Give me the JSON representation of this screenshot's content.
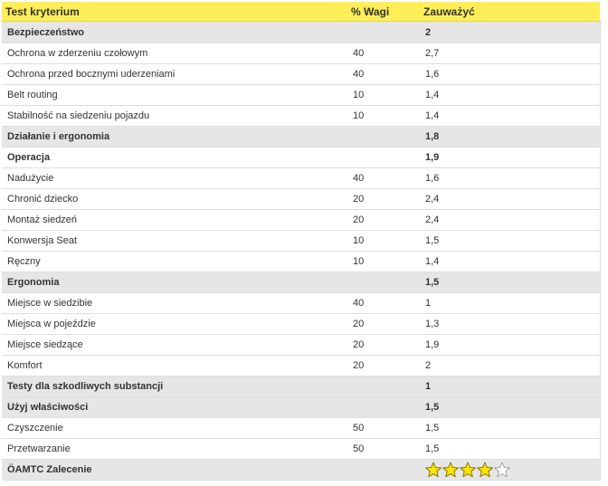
{
  "table": {
    "headers": [
      "Test kryterium",
      "% Wagi",
      "Zauważyć"
    ],
    "rows": [
      {
        "kind": "sec",
        "label": "Bezpieczeństwo",
        "weight": "",
        "value": "2"
      },
      {
        "kind": "item",
        "label": "Ochrona w zderzeniu czołowym",
        "weight": "40",
        "value": "2,7"
      },
      {
        "kind": "item",
        "label": "Ochrona przed bocznymi uderzeniami",
        "weight": "40",
        "value": "1,6"
      },
      {
        "kind": "item",
        "label": "Belt routing",
        "weight": "10",
        "value": "1,4"
      },
      {
        "kind": "item",
        "label": "Stabilność na siedzeniu pojazdu",
        "weight": "10",
        "value": "1,4"
      },
      {
        "kind": "sec",
        "label": "Działanie i ergonomia",
        "weight": "",
        "value": "1,8"
      },
      {
        "kind": "sub",
        "label": "Operacja",
        "weight": "",
        "value": "1,9"
      },
      {
        "kind": "item",
        "label": "Nadużycie",
        "weight": "40",
        "value": "1,6"
      },
      {
        "kind": "item",
        "label": "Chronić dziecko",
        "weight": "20",
        "value": "2,4"
      },
      {
        "kind": "item",
        "label": "Montaż siedzeń",
        "weight": "20",
        "value": "2,4"
      },
      {
        "kind": "item",
        "label": "Konwersja Seat",
        "weight": "10",
        "value": "1,5"
      },
      {
        "kind": "item",
        "label": "Ręczny",
        "weight": "10",
        "value": "1,4"
      },
      {
        "kind": "sec",
        "label": "Ergonomia",
        "weight": "",
        "value": "1,5"
      },
      {
        "kind": "item",
        "label": "Miejsce w siedzibie",
        "weight": "40",
        "value": "1"
      },
      {
        "kind": "item",
        "label": "Miejsca w pojeździe",
        "weight": "20",
        "value": "1,3"
      },
      {
        "kind": "item",
        "label": "Miejsce siedzące",
        "weight": "20",
        "value": "1,9"
      },
      {
        "kind": "item",
        "label": "Komfort",
        "weight": "20",
        "value": "2"
      },
      {
        "kind": "sec",
        "label": "Testy dla szkodliwych substancji",
        "weight": "",
        "value": "1"
      },
      {
        "kind": "sec",
        "label": "Użyj właściwości",
        "weight": "",
        "value": "1,5"
      },
      {
        "kind": "item",
        "label": "Czyszczenie",
        "weight": "50",
        "value": "1,5"
      },
      {
        "kind": "item",
        "label": "Przetwarzanie",
        "weight": "50",
        "value": "1,5"
      }
    ],
    "recommendation": {
      "label": "ÖAMTC Zalecenie",
      "stars_filled": 4,
      "stars_total": 5,
      "star_color": "#ffe600",
      "star_outline": "#7a6a00"
    }
  }
}
